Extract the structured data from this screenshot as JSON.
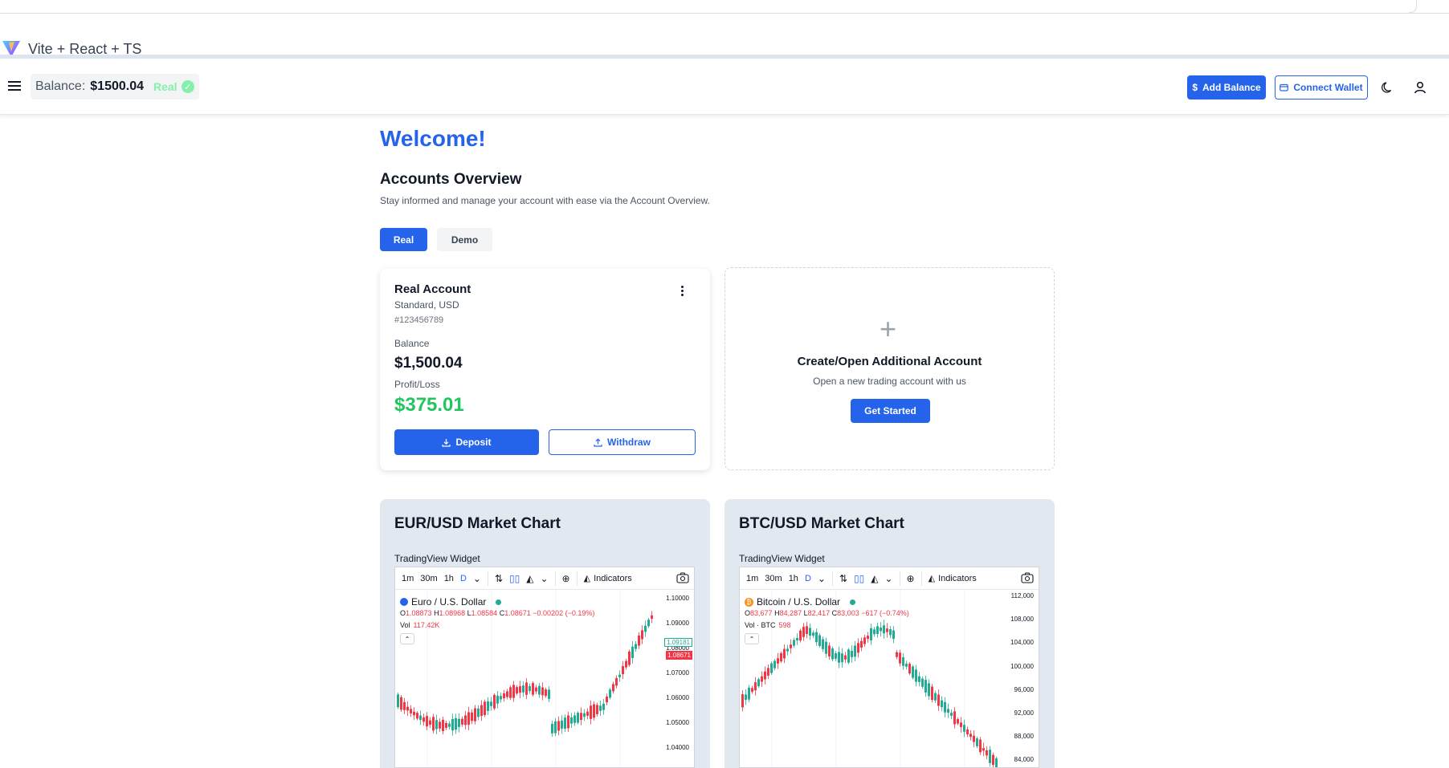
{
  "browser": {
    "tab_title": "Vite + React + TS"
  },
  "header": {
    "balance_label": "Balance:",
    "balance_value": "$1500.04",
    "account_tag": "Real",
    "add_balance_label": "Add Balance",
    "connect_wallet_label": "Connect Wallet"
  },
  "main": {
    "welcome": "Welcome!",
    "section_title": "Accounts Overview",
    "section_subtitle": "Stay informed and manage your account with ease via the Account Overview.",
    "tabs": [
      {
        "label": "Real",
        "active": true
      },
      {
        "label": "Demo",
        "active": false
      }
    ]
  },
  "account": {
    "name": "Real Account",
    "type": "Standard, USD",
    "number": "#123456789",
    "balance_label": "Balance",
    "balance_value": "$1,500.04",
    "pl_label": "Profit/Loss",
    "pl_value": "$375.01",
    "deposit_label": "Deposit",
    "withdraw_label": "Withdraw"
  },
  "create_account": {
    "title": "Create/Open Additional Account",
    "subtitle": "Open a new trading account with us",
    "button_label": "Get Started"
  },
  "charts": [
    {
      "title": "EUR/USD Market Chart",
      "widget_label": "TradingView Widget",
      "timeframes": [
        "1m",
        "30m",
        "1h",
        "D"
      ],
      "indicators_label": "Indicators",
      "symbol": "Euro / U.S. Dollar",
      "ohlc": {
        "o": "1.08873",
        "h": "1.08968",
        "l": "1.08584",
        "c": "1.08671",
        "chg": "−0.00202 (−0.19%)"
      },
      "vol_label": "Vol",
      "vol_value": "117.42K",
      "axis_ticks": [
        "1.10000",
        "1.09000",
        "1.08000",
        "1.07000",
        "1.06000",
        "1.05000",
        "1.04000"
      ],
      "last_price": "1.08671",
      "high_price": "1.09181"
    },
    {
      "title": "BTC/USD Market Chart",
      "widget_label": "TradingView Widget",
      "timeframes": [
        "1m",
        "30m",
        "1h",
        "D"
      ],
      "indicators_label": "Indicators",
      "symbol": "Bitcoin / U.S. Dollar",
      "ohlc": {
        "o": "83,677",
        "h": "84,287",
        "l": "82,417",
        "c": "83,003",
        "chg": "−617 (−0.74%)"
      },
      "vol_label": "Vol · BTC",
      "vol_value": "598",
      "axis_ticks": [
        "112,000",
        "108,000",
        "104,000",
        "100,000",
        "96,000",
        "92,000",
        "88,000",
        "84,000"
      ],
      "last_price": "83,003"
    }
  ],
  "colors": {
    "accent": "#2563eb",
    "profit": "#22c55e",
    "candle_up": "#22ab94",
    "candle_down": "#f23645"
  }
}
